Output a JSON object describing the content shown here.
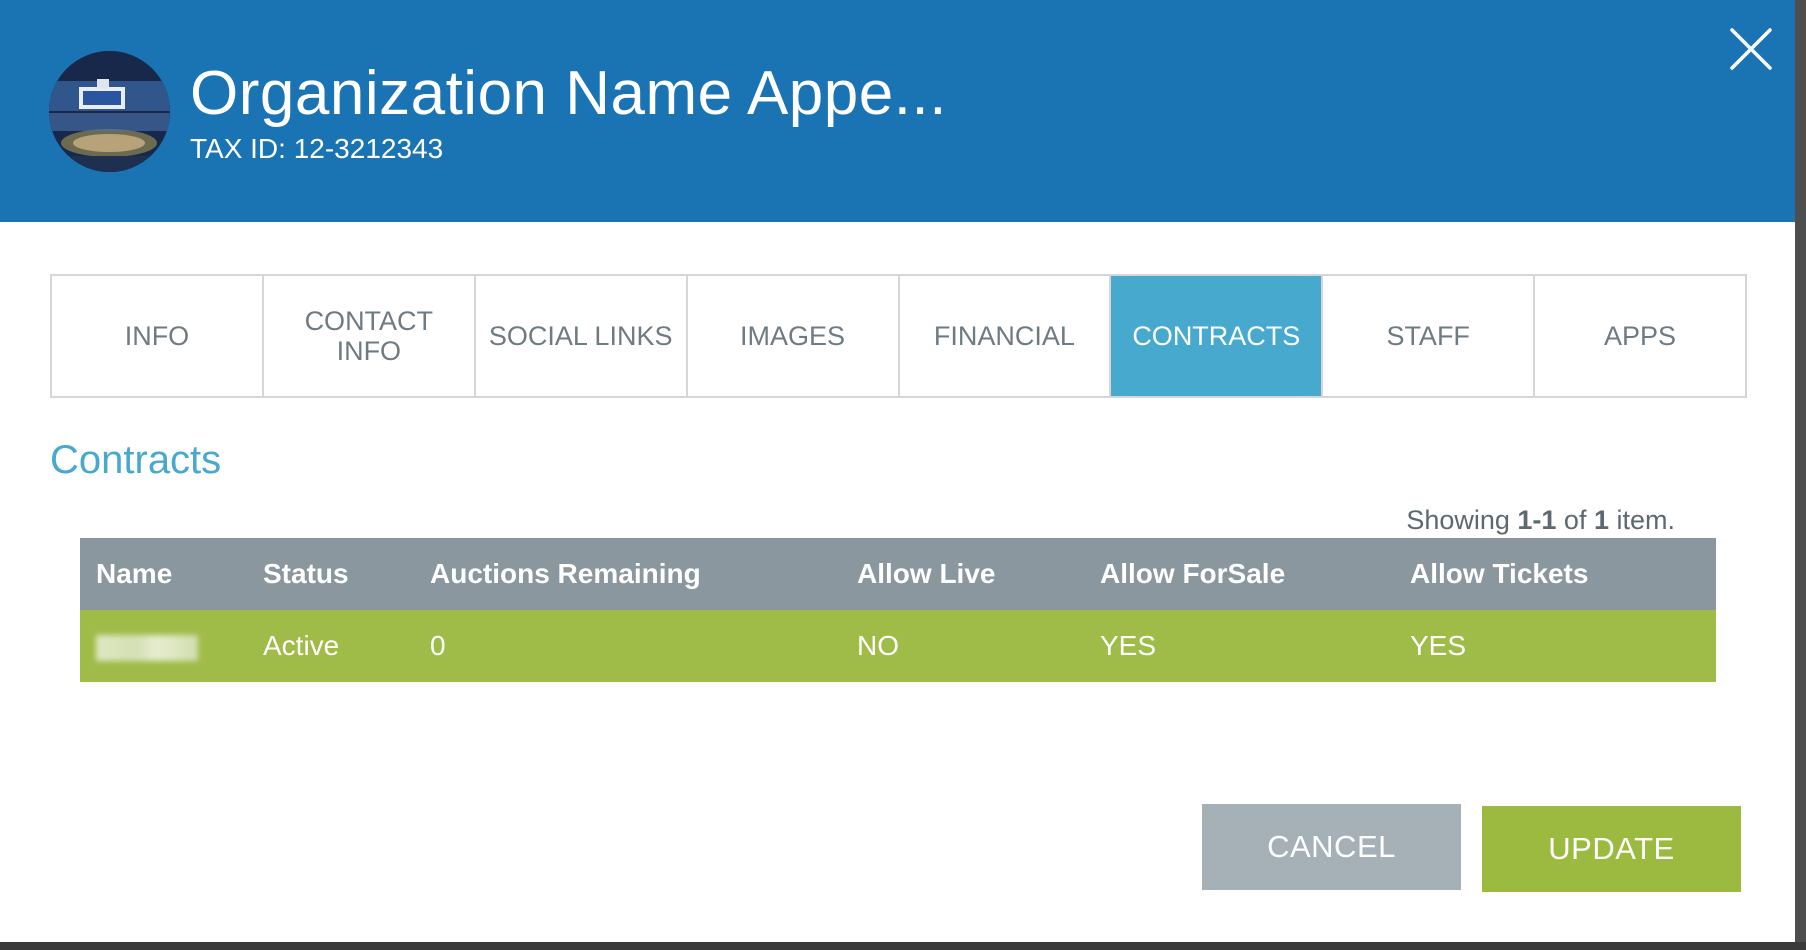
{
  "header": {
    "org_name": "Organization Name Appe...",
    "tax_id": "TAX ID: 12-3212343",
    "avatar_icon": "arena-photo-avatar",
    "close_icon": "close-icon",
    "background_color": "#1a73b3"
  },
  "tabs": [
    {
      "label": "INFO",
      "active": false
    },
    {
      "label": "CONTACT INFO",
      "active": false
    },
    {
      "label": "SOCIAL LINKS",
      "active": false
    },
    {
      "label": "IMAGES",
      "active": false
    },
    {
      "label": "FINANCIAL",
      "active": false
    },
    {
      "label": "CONTRACTS",
      "active": true
    },
    {
      "label": "STAFF",
      "active": false
    },
    {
      "label": "APPS",
      "active": false
    }
  ],
  "section": {
    "title": "Contracts",
    "summary_prefix": "Showing ",
    "summary_range": "1-1",
    "summary_mid": " of ",
    "summary_total": "1",
    "summary_suffix": " item."
  },
  "table": {
    "columns": [
      "Name",
      "Status",
      "Auctions Remaining",
      "Allow Live",
      "Allow ForSale",
      "Allow Tickets"
    ],
    "rows": [
      {
        "name": "",
        "status": "Active",
        "auctions_remaining": "0",
        "allow_live": "NO",
        "allow_forsale": "YES",
        "allow_tickets": "YES"
      }
    ]
  },
  "buttons": {
    "cancel": "CANCEL",
    "update": "UPDATE"
  },
  "colors": {
    "active_tab": "#48a9cf",
    "row_active": "#9fbb48",
    "header_row": "#8a979e",
    "cancel": "#a5b1b7",
    "update": "#9cba3f"
  }
}
